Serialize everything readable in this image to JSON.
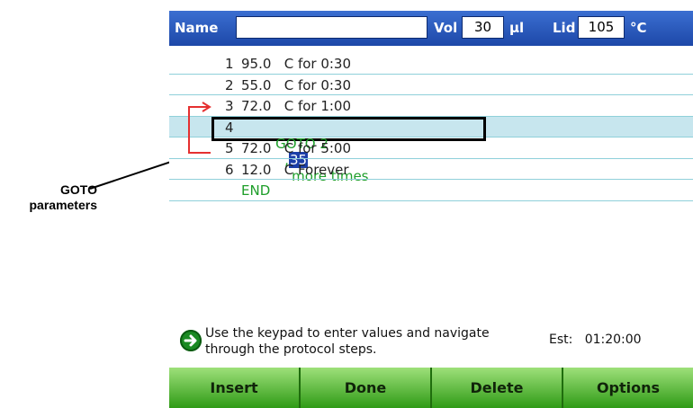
{
  "callout": {
    "line1": "GOTO",
    "line2": "parameters"
  },
  "header": {
    "name_label": "Name",
    "name_value": "",
    "vol_label": "Vol",
    "vol_value": "30",
    "vol_unit": "µl",
    "lid_label": "Lid",
    "lid_value": "105",
    "lid_unit": "°C"
  },
  "steps": [
    {
      "num": "1",
      "text": "95.0   C for 0:30"
    },
    {
      "num": "2",
      "text": "55.0   C for 0:30"
    },
    {
      "num": "3",
      "text": "72.0   C for 1:00"
    },
    {
      "num": "4",
      "goto_label": "GOTO 2",
      "sep": ",",
      "count": "35",
      "suffix": "more times"
    },
    {
      "num": "5",
      "text": "72.0   C for 5:00"
    },
    {
      "num": "6",
      "text": "12.0   C Forever"
    },
    {
      "num": "",
      "text": "END"
    }
  ],
  "hint": {
    "line1": "Use the keypad to enter values and navigate",
    "line2": "through the protocol steps."
  },
  "estimate": "Est:   01:20:00",
  "buttons": {
    "insert": "Insert",
    "done": "Done",
    "delete": "Delete",
    "options": "Options"
  },
  "icons": {
    "hint": "green-arrow-icon"
  },
  "colors": {
    "header": "#2a5cc0",
    "button": "#4fb526",
    "goto_text": "#1e9e2a",
    "loop_arrow": "#e53030"
  }
}
